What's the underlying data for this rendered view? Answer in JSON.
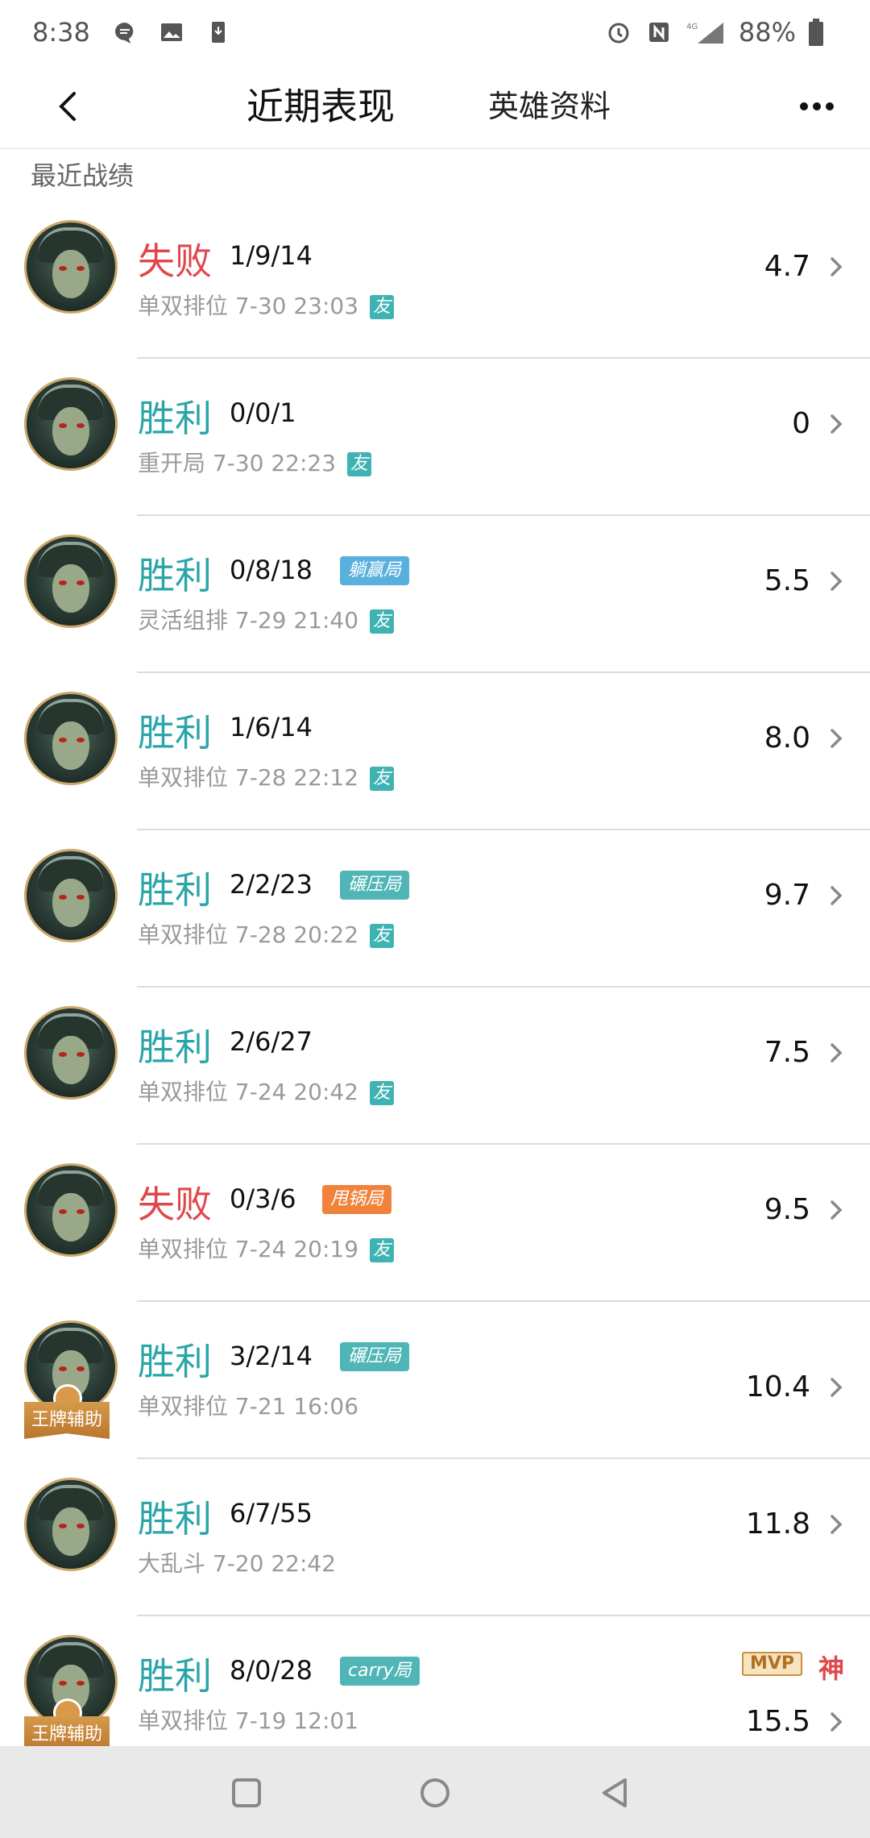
{
  "status_bar": {
    "time": "8:38",
    "network": "4G",
    "battery": "88%"
  },
  "navbar": {
    "tab_recent": "近期表现",
    "tab_hero": "英雄资料"
  },
  "section_title": "最近战绩",
  "ace_badge_label": "王牌辅助",
  "friend_label": "友",
  "mvp_label": "MVP",
  "god_label": "神",
  "matches": [
    {
      "result": "失败",
      "outcome": "loss",
      "kda": "1/9/14",
      "tag": "",
      "tag_color": "",
      "mode": "单双排位",
      "time": "7-30 23:03",
      "friend": true,
      "score": "4.7",
      "ace": false,
      "mvp": false
    },
    {
      "result": "胜利",
      "outcome": "win",
      "kda": "0/0/1",
      "tag": "",
      "tag_color": "",
      "mode": "重开局",
      "time": "7-30 22:23",
      "friend": true,
      "score": "0",
      "ace": false,
      "mvp": false
    },
    {
      "result": "胜利",
      "outcome": "win",
      "kda": "0/8/18",
      "tag": "躺赢局",
      "tag_color": "blue",
      "mode": "灵活组排",
      "time": "7-29 21:40",
      "friend": true,
      "score": "5.5",
      "ace": false,
      "mvp": false
    },
    {
      "result": "胜利",
      "outcome": "win",
      "kda": "1/6/14",
      "tag": "",
      "tag_color": "",
      "mode": "单双排位",
      "time": "7-28 22:12",
      "friend": true,
      "score": "8.0",
      "ace": false,
      "mvp": false
    },
    {
      "result": "胜利",
      "outcome": "win",
      "kda": "2/2/23",
      "tag": "碾压局",
      "tag_color": "teal",
      "mode": "单双排位",
      "time": "7-28 20:22",
      "friend": true,
      "score": "9.7",
      "ace": false,
      "mvp": false
    },
    {
      "result": "胜利",
      "outcome": "win",
      "kda": "2/6/27",
      "tag": "",
      "tag_color": "",
      "mode": "单双排位",
      "time": "7-24 20:42",
      "friend": true,
      "score": "7.5",
      "ace": false,
      "mvp": false
    },
    {
      "result": "失败",
      "outcome": "loss",
      "kda": "0/3/6",
      "tag": "甩锅局",
      "tag_color": "orange",
      "mode": "单双排位",
      "time": "7-24 20:19",
      "friend": true,
      "score": "9.5",
      "ace": false,
      "mvp": false
    },
    {
      "result": "胜利",
      "outcome": "win",
      "kda": "3/2/14",
      "tag": "碾压局",
      "tag_color": "teal",
      "mode": "单双排位",
      "time": "7-21 16:06",
      "friend": false,
      "score": "10.4",
      "ace": true,
      "mvp": false
    },
    {
      "result": "胜利",
      "outcome": "win",
      "kda": "6/7/55",
      "tag": "",
      "tag_color": "",
      "mode": "大乱斗",
      "time": "7-20 22:42",
      "friend": false,
      "score": "11.8",
      "ace": false,
      "mvp": false
    },
    {
      "result": "胜利",
      "outcome": "win",
      "kda": "8/0/28",
      "tag": "carry局",
      "tag_color": "teal",
      "mode": "单双排位",
      "time": "7-19 12:01",
      "friend": false,
      "score": "15.5",
      "ace": true,
      "mvp": true
    }
  ]
}
